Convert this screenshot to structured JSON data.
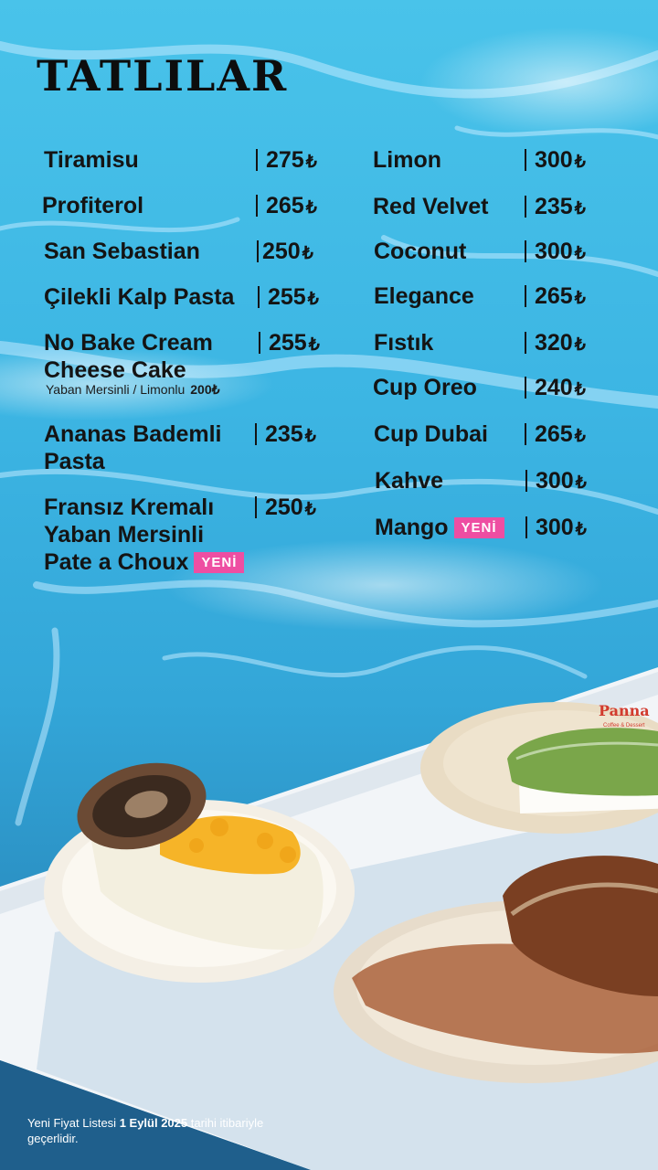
{
  "title": "TATLILAR",
  "currency": "₺",
  "badge_new": "YENİ",
  "left_items": [
    {
      "name": "Tiramisu",
      "price": "275"
    },
    {
      "name": "Profiterol",
      "price": "265"
    },
    {
      "name": "San Sebastian",
      "price": "250"
    },
    {
      "name": "Çilekli Kalp Pasta",
      "price": "255"
    },
    {
      "name_line1": "No Bake Cream",
      "name_line2": "Cheese Cake",
      "price": "255",
      "variant_label": "Yaban Mersinli / Limonlu",
      "variant_price": "200"
    },
    {
      "name_line1": "Ananas Bademli",
      "name_line2": "Pasta",
      "price": "235"
    },
    {
      "name_line1": "Fransız Kremalı",
      "name_line2": "Yaban Mersinli",
      "name_line3": "Pate a Choux",
      "price": "250",
      "is_new": true
    }
  ],
  "right_items": [
    {
      "name": "Limon",
      "price": "300"
    },
    {
      "name": "Red Velvet",
      "price": "235"
    },
    {
      "name": "Coconut",
      "price": "300"
    },
    {
      "name": "Elegance",
      "price": "265"
    },
    {
      "name": "Fıstık",
      "price": "320"
    },
    {
      "name": "Cup Oreo",
      "price": "240"
    },
    {
      "name": "Cup Dubai",
      "price": "265"
    },
    {
      "name": "Kahve",
      "price": "300"
    },
    {
      "name": "Mango",
      "price": "300",
      "is_new": true
    }
  ],
  "footer": {
    "text_before": "Yeni Fiyat Listesi ",
    "date": "1 Eylül 2025",
    "text_after": " tarihi itibariyle geçerlidir."
  },
  "photo": {
    "plate_brand": "Panna",
    "plate_brand_sub": "Coffee & Dessert"
  },
  "colors": {
    "badge": "#ee4ea2",
    "text": "#141414",
    "water": "#3cb5e3"
  }
}
